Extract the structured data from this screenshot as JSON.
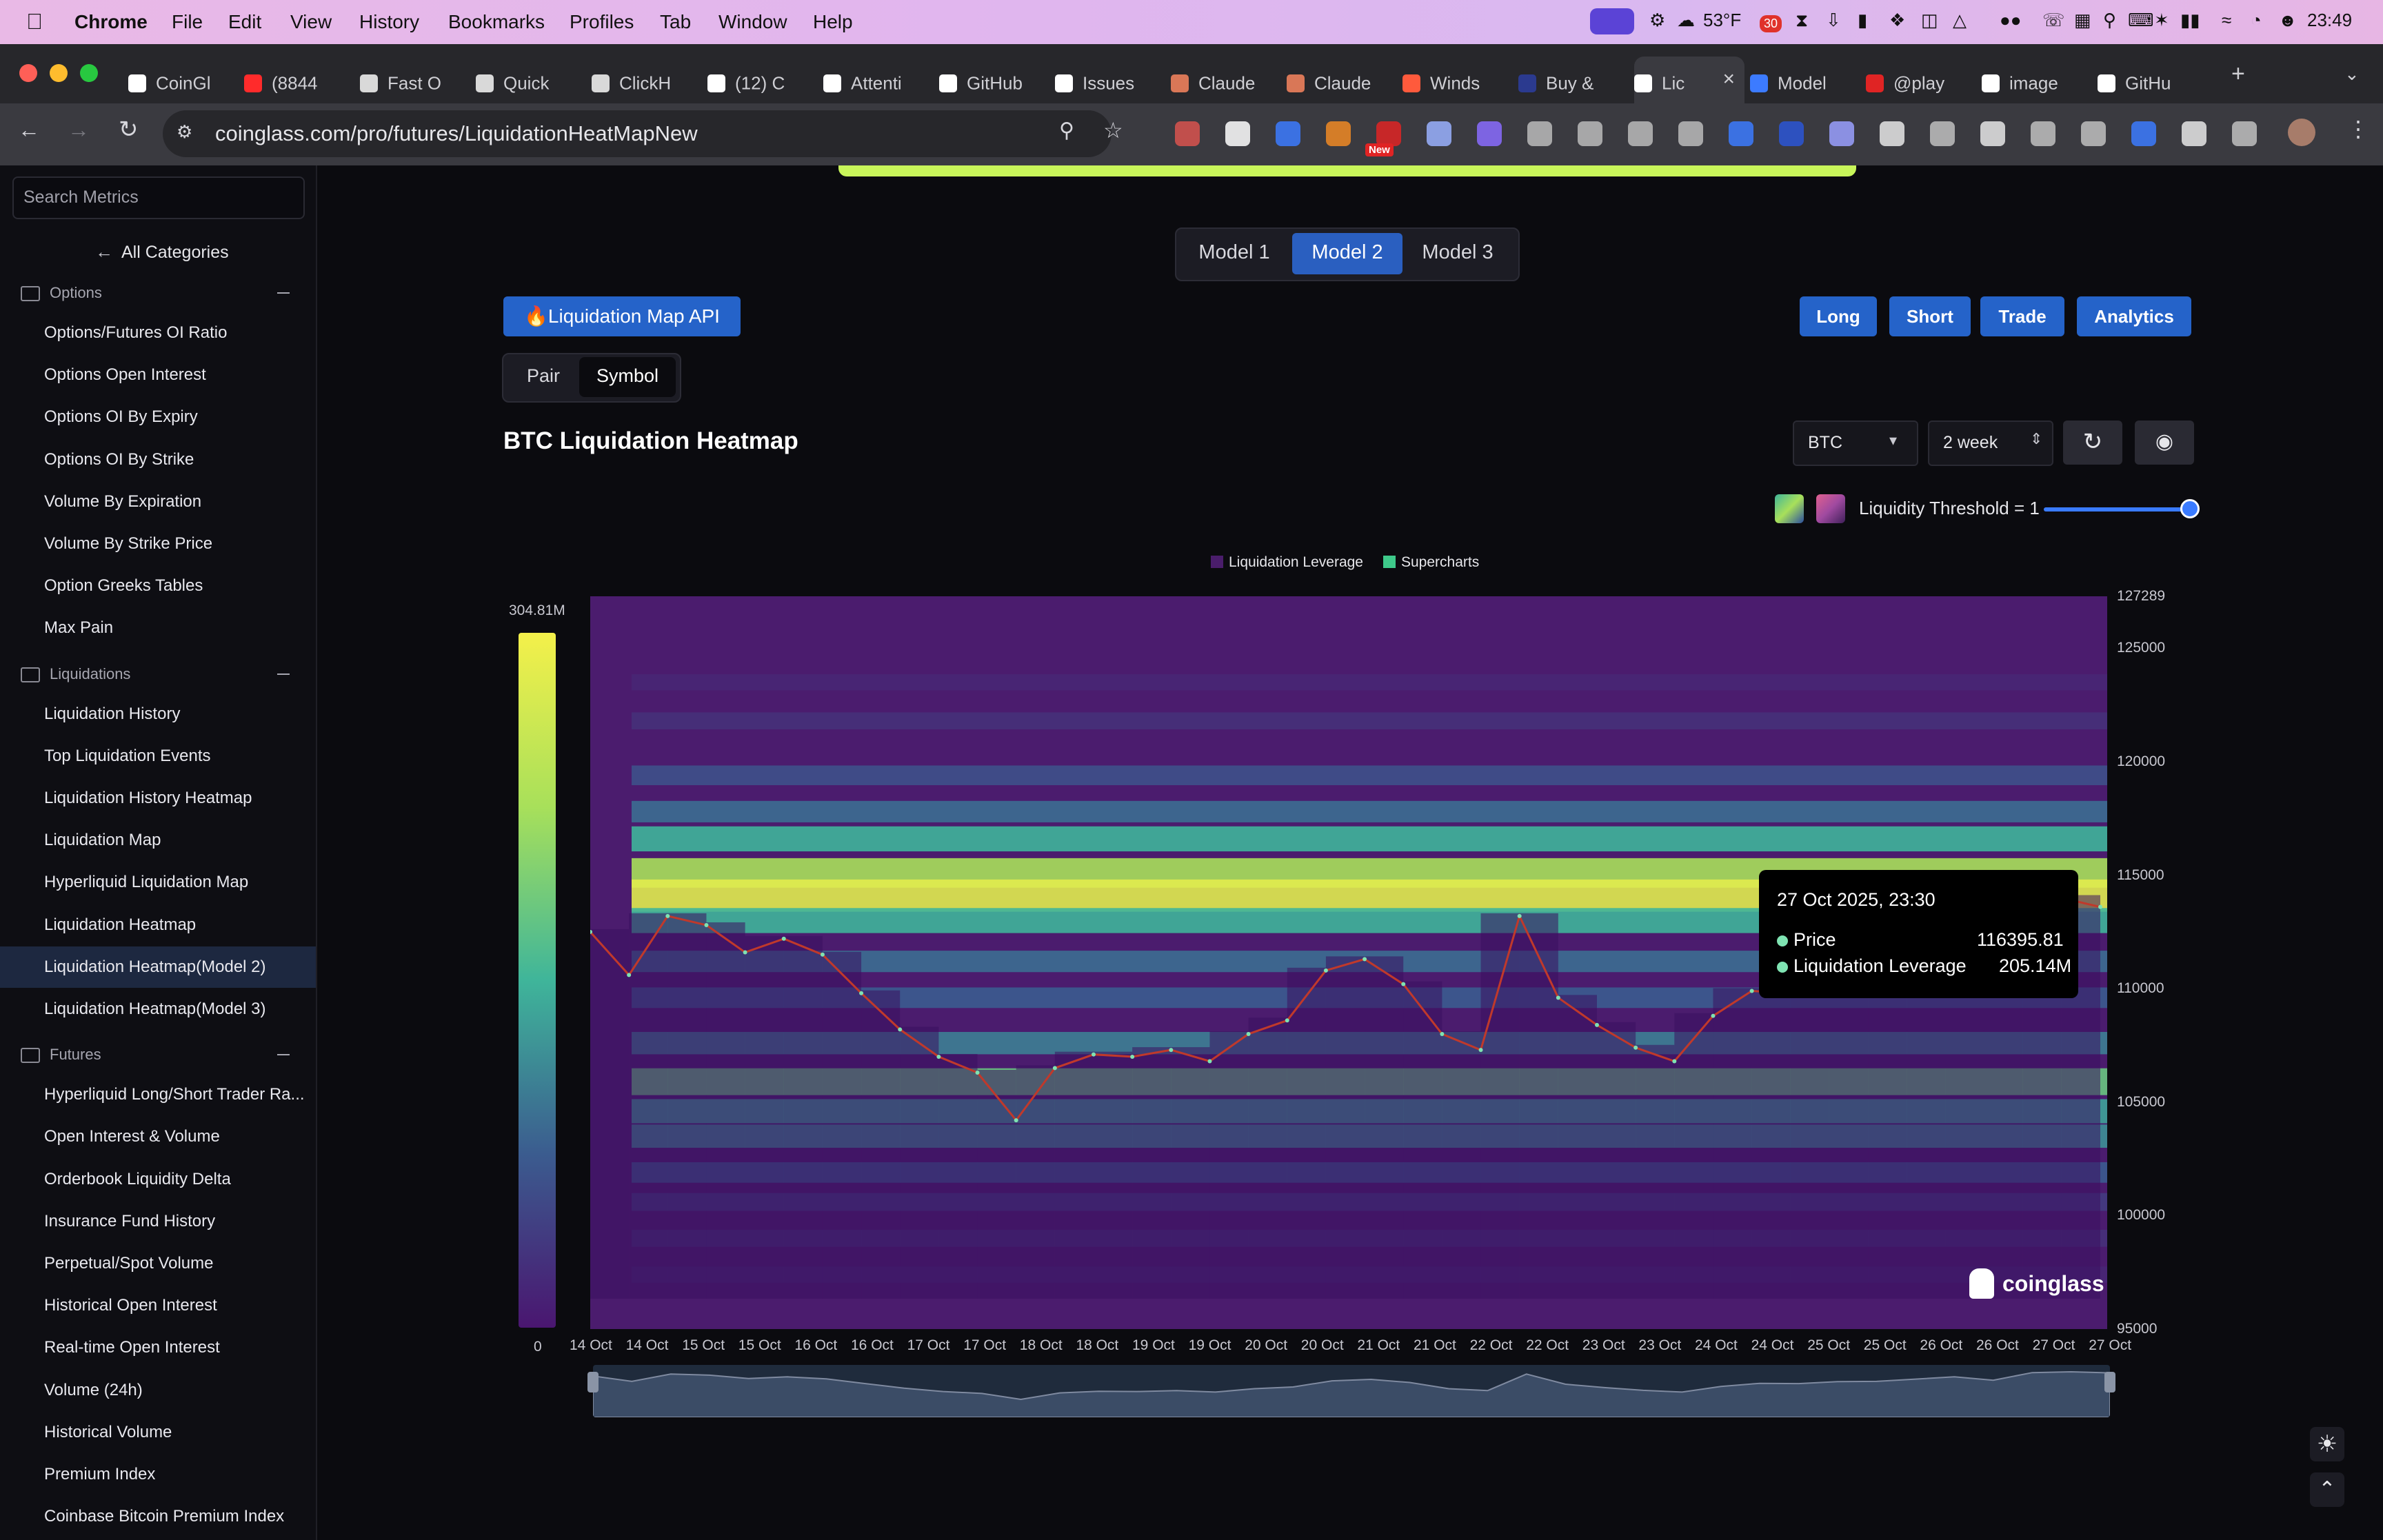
{
  "menubar": {
    "app": "Chrome",
    "items": [
      "File",
      "Edit",
      "View",
      "History",
      "Bookmarks",
      "Profiles",
      "Tab",
      "Window",
      "Help"
    ],
    "weather": "53°F",
    "badge": "30",
    "clock": "23:49"
  },
  "tabs": [
    {
      "label": "CoinGl",
      "icon_color": "#ffffff"
    },
    {
      "label": "(8844",
      "icon_color": "#ff2b2b"
    },
    {
      "label": "Fast O",
      "icon_color": "#d9d9d9"
    },
    {
      "label": "Quick",
      "icon_color": "#d9d9d9"
    },
    {
      "label": "ClickH",
      "icon_color": "#d9d9d9"
    },
    {
      "label": "(12) C",
      "icon_color": "#ffffff"
    },
    {
      "label": "Attenti",
      "icon_color": "#ffffff"
    },
    {
      "label": "GitHub",
      "icon_color": "#ffffff"
    },
    {
      "label": "Issues",
      "icon_color": "#ffffff"
    },
    {
      "label": "Claude",
      "icon_color": "#d97757"
    },
    {
      "label": "Claude",
      "icon_color": "#d97757"
    },
    {
      "label": "Winds",
      "icon_color": "#ff5a3c"
    },
    {
      "label": "Buy &",
      "icon_color": "#2b3a8f"
    },
    {
      "label": "Lic",
      "icon_color": "#ffffff",
      "active": true
    },
    {
      "label": "Model",
      "icon_color": "#3c7bff"
    },
    {
      "label": "@play",
      "icon_color": "#e02424"
    },
    {
      "label": "image",
      "icon_color": "#ffffff"
    },
    {
      "label": "GitHu",
      "icon_color": "#ffffff"
    }
  ],
  "browser": {
    "url": "coinglass.com/pro/futures/LiquidationHeatMapNew",
    "new_badge": "New"
  },
  "sidebar": {
    "search_placeholder": "Search Metrics",
    "all_categories": "All Categories",
    "sections": [
      {
        "title": "Options",
        "items": [
          "Options/Futures OI Ratio",
          "Options Open Interest",
          "Options OI By Expiry",
          "Options OI By Strike",
          "Volume By Expiration",
          "Volume By Strike Price",
          "Option Greeks Tables",
          "Max Pain"
        ]
      },
      {
        "title": "Liquidations",
        "items": [
          "Liquidation History",
          "Top Liquidation Events",
          "Liquidation History Heatmap",
          "Liquidation Map",
          "Hyperliquid Liquidation Map",
          "Liquidation Heatmap",
          "Liquidation Heatmap(Model 2)",
          "Liquidation Heatmap(Model 3)"
        ]
      },
      {
        "title": "Futures",
        "items": [
          "Hyperliquid Long/Short Trader Ra...",
          "Open Interest & Volume",
          "Orderbook Liquidity Delta",
          "Insurance Fund History",
          "Perpetual/Spot Volume",
          "Historical Open Interest",
          "Real-time Open Interest",
          "Volume (24h)",
          "Historical Volume",
          "Premium Index",
          "Coinbase Bitcoin Premium Index"
        ]
      }
    ],
    "active_item": "Liquidation Heatmap(Model 2)"
  },
  "main": {
    "models": [
      "Model 1",
      "Model 2",
      "Model 3"
    ],
    "active_model": "Model 2",
    "api_button": "🔥Liquidation Map API",
    "pair_tabs": [
      "Pair",
      "Symbol"
    ],
    "active_pair_tab": "Symbol",
    "actions": [
      "Long",
      "Short",
      "Trade",
      "Analytics"
    ],
    "title": "BTC Liquidation Heatmap",
    "symbol_select": "BTC",
    "range_select": "2 week",
    "threshold_label": "Liquidity Threshold = 1",
    "threshold_value": 1.0,
    "watermark": "coinglass"
  },
  "chart_data": {
    "type": "heatmap",
    "title": "BTC Liquidation Heatmap",
    "legend": [
      "Liquidation Leverage",
      "Supercharts"
    ],
    "legend_colors": [
      "#4a1d6b",
      "#3ec98a"
    ],
    "colorbar": {
      "max_label": "304.81M",
      "min_label": "0",
      "colors": [
        "#4a1670",
        "#3b5c8f",
        "#3fb59a",
        "#a8e05a",
        "#f4f04a"
      ]
    },
    "x_ticks": [
      "14 Oct",
      "14 Oct",
      "15 Oct",
      "15 Oct",
      "16 Oct",
      "16 Oct",
      "17 Oct",
      "17 Oct",
      "18 Oct",
      "18 Oct",
      "19 Oct",
      "19 Oct",
      "20 Oct",
      "20 Oct",
      "21 Oct",
      "21 Oct",
      "22 Oct",
      "22 Oct",
      "23 Oct",
      "23 Oct",
      "24 Oct",
      "24 Oct",
      "25 Oct",
      "25 Oct",
      "26 Oct",
      "26 Oct",
      "27 Oct",
      "27 Oct"
    ],
    "y_ticks": [
      127289,
      125000,
      120000,
      115000,
      110000,
      105000,
      100000,
      95000
    ],
    "ylim": [
      95000,
      127289
    ],
    "price_series": {
      "name": "Price",
      "values": [
        112500,
        110600,
        113200,
        112800,
        111600,
        112200,
        111500,
        109800,
        108200,
        107000,
        106300,
        104200,
        106500,
        107100,
        107000,
        107300,
        106800,
        108000,
        108600,
        110800,
        111300,
        110200,
        108000,
        107300,
        113200,
        109600,
        108400,
        107400,
        106800,
        108800,
        109900,
        109800,
        110500,
        110600,
        111400,
        112200,
        111000,
        113700,
        114000,
        113600
      ]
    },
    "band_levels": [
      123500,
      121800,
      119400,
      117800,
      116600,
      115100,
      114100,
      113000,
      111200,
      109600,
      107600,
      105900,
      104600,
      103500,
      101900,
      100600,
      99000,
      97400
    ],
    "band_intensity": [
      0.05,
      0.1,
      0.25,
      0.35,
      0.55,
      0.8,
      0.95,
      0.55,
      0.35,
      0.3,
      0.4,
      0.65,
      0.5,
      0.45,
      0.3,
      0.15,
      0.1,
      0.05
    ],
    "tooltip": {
      "date": "27 Oct 2025, 23:30",
      "price_label": "Price",
      "price": "116395.81",
      "leverage_label": "Liquidation Leverage",
      "leverage": "205.14M"
    }
  }
}
